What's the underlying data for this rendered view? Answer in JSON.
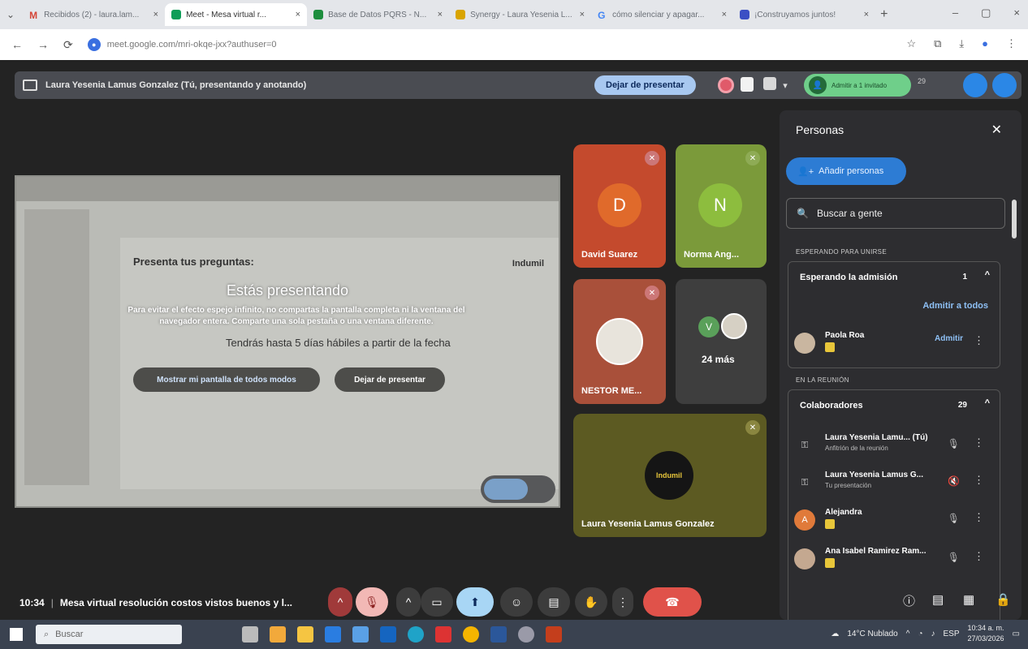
{
  "browser": {
    "tabs": [
      {
        "title": "Recibidos (2) - laura.lam...",
        "favicon_color": "#d44638",
        "favicon_glyph": "M"
      },
      {
        "title": "Meet - Mesa virtual r...",
        "favicon_color": "#0f9d58",
        "favicon_glyph": "◉"
      },
      {
        "title": "Base de Datos PQRS - N...",
        "favicon_color": "#1e8e3e",
        "favicon_glyph": "▦"
      },
      {
        "title": "Synergy - Laura Yesenia L...",
        "favicon_color": "#d9a400",
        "favicon_glyph": "■"
      },
      {
        "title": "cómo silenciar y apagar...",
        "favicon_color": "#4285f4",
        "favicon_glyph": "G"
      },
      {
        "title": "¡Construyamos juntos!",
        "favicon_color": "#3b4fc4",
        "favicon_glyph": "■"
      }
    ],
    "url": "meet.google.com/mri-okqe-jxx?authuser=0",
    "site_icon_glyph": "●",
    "back_glyph": "←",
    "forward_glyph": "→",
    "reload_glyph": "⟳",
    "star_glyph": "☆",
    "extensions_glyph": "⧉",
    "download_glyph": "⤓",
    "profile_glyph": "●",
    "menu_glyph": "⋮",
    "tab_close_glyph": "×",
    "new_tab_glyph": "+",
    "chevron_glyph": "⌄",
    "window": {
      "minimize": "–",
      "maximize": "▢",
      "close": "×"
    }
  },
  "meet": {
    "presenting_label": "Laura Yesenia Lamus Gonzalez (Tú, presentando y anotando)",
    "stop_presenting": "Dejar de presentar",
    "admit_pill_label": "Admitir a 1 invitado",
    "participants_short": "29",
    "shared_screen": {
      "slide_title": "Presenta tus preguntas:",
      "slide_logo": "Indumil",
      "slide_subtitle": "Tendrás hasta 5 días hábiles a partir de la fecha",
      "overlay_title": "Estás presentando",
      "overlay_text": "Para evitar el efecto espejo infinito, no compartas la pantalla completa ni la ventana del navegador entera. Comparte una sola pestaña o una ventana diferente.",
      "show_anyway": "Mostrar mi pantalla de todos modos",
      "stop": "Dejar de presentar"
    },
    "tiles": [
      {
        "name": "David Suarez",
        "initial": "D",
        "bg": "#c44a2d",
        "avatar": "#e06a2b"
      },
      {
        "name": "Norma Ang...",
        "initial": "N",
        "bg": "#7b9a3a",
        "avatar": "#8dbd3e"
      },
      {
        "name": "NESTOR ME...",
        "bg": "#a9503a"
      },
      {
        "more_label": "24 más",
        "initial": "V"
      },
      {
        "name": "Laura Yesenia Lamus Gonzalez",
        "logo": "Indumil",
        "bg": "#5c5a22"
      }
    ],
    "bottom": {
      "time": "10:34",
      "meeting_title": "Mesa virtual resolución costos vistos buenos y l..."
    }
  },
  "people_panel": {
    "title": "Personas",
    "add_people": "Añadir personas",
    "search_placeholder": "Buscar a gente",
    "waiting_section": "ESPERANDO PARA UNIRSE",
    "waiting_group": "Esperando la admisión",
    "waiting_count": "1",
    "admit_all": "Admitir a todos",
    "waiting_person": {
      "name": "Paola Roa",
      "action": "Admitir"
    },
    "in_meeting_section": "EN LA REUNIÓN",
    "collab_group": "Colaboradores",
    "collab_count": "29",
    "members": [
      {
        "name": "Laura Yesenia Lamu... (Tú)",
        "sub": "Anfitrión de la reunión"
      },
      {
        "name": "Laura Yesenia Lamus G...",
        "sub": "Tu presentación"
      },
      {
        "name": "Alejandra",
        "initial": "A",
        "avatar_color": "#e07a3a"
      },
      {
        "name": "Ana Isabel Ramirez Ram..."
      }
    ]
  },
  "taskbar": {
    "search_placeholder": "Buscar",
    "weather": "14°C Nublado",
    "lang": "ESP",
    "time": "10:34 a. m.",
    "date": "27/03/2026"
  }
}
